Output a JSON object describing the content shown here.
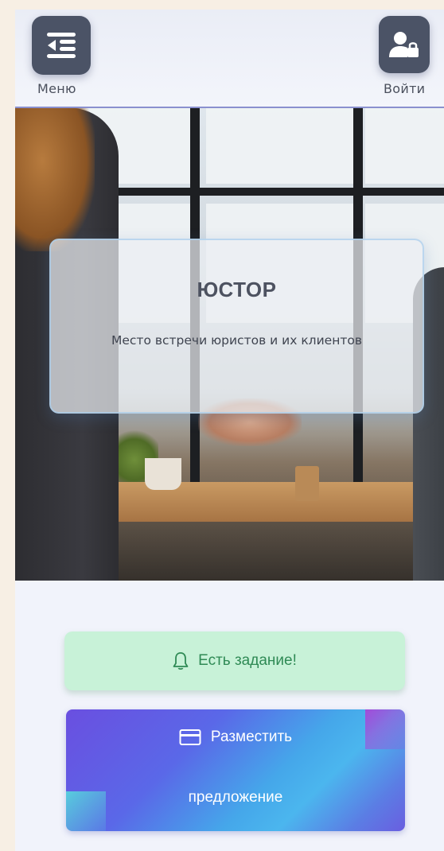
{
  "header": {
    "menu_label": "Меню",
    "login_label": "Войти"
  },
  "hero": {
    "title": "ЮСТОР",
    "subtitle": "Место встречи юристов и их клиентов"
  },
  "actions": {
    "task_label": "Есть задание!",
    "offer_label_line1": "Разместить",
    "offer_label_line2": "предложение"
  },
  "colors": {
    "header_button": "#4b5366",
    "task_button_bg": "#c8f2d8",
    "task_button_text": "#2f8a55",
    "offer_gradient_start": "#6a4fe0",
    "offer_gradient_mid": "#45a7ea"
  },
  "icons": {
    "menu": "menu-collapse-icon",
    "login": "user-lock-icon",
    "task": "bell-icon",
    "offer": "credit-card-icon"
  }
}
